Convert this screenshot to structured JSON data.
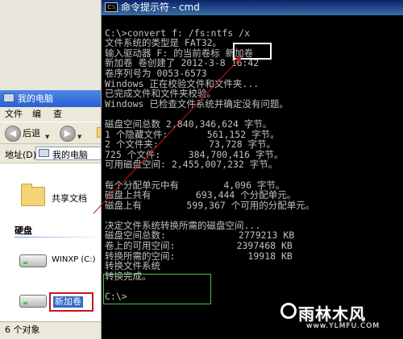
{
  "explorer": {
    "title": "我的电脑",
    "menu": [
      "文件",
      "编",
      "查"
    ],
    "back_label": "后退",
    "address_label": "地址(D)",
    "address_value": "我的电脑",
    "folder_label": "共享文档",
    "section_hard_disk": "硬盘",
    "drive1_label": "WINXP (C:)",
    "drive2_label": "新加卷",
    "status_text": "6 个对象"
  },
  "cmd": {
    "title": "命令提示符 - cmd",
    "icon_text": "C:\\",
    "lines": [
      "",
      "C:\\>convert f: /fs:ntfs /x",
      "文件系统的类型是 FAT32。",
      "输入驱动器 F: 的当前卷标 新加卷",
      "新加卷 卷创建了 2012-3-8 16:42",
      "卷序列号为 0053-6573",
      "Windows 正在校验文件和文件夹...",
      "已完成文件和文件夹校验。",
      "Windows 已检查文件系统并确定没有问题。",
      "",
      "磁盘空间总数 2,840,346,624 字节。",
      "1 个隐藏文件:       561,152 字节。",
      "2 个文件夹:         73,728 字节。",
      "725 个文件:     384,700,416 字节。",
      "可用磁盘空间: 2,455,007,232 字节。",
      "",
      "每个分配单元中有        4,096 字节。",
      "磁盘上共有        693,444 个分配单元。",
      "磁盘上有        599,367 个可用的分配单元。",
      "",
      "决定文件系统转换所需的磁盘空间...",
      "磁盘空间总数:             2779213 KB",
      "卷上的可用空间:           2397468 KB",
      "转换所需的空间:             19918 KB",
      "转换文件系统",
      "转换完成。",
      "",
      "C:\\>"
    ]
  },
  "watermark": {
    "brand": "雨林木风",
    "url": "www.YLMFU.COM"
  },
  "colors": {
    "cmd_text": "#c0c0c0",
    "highlight_red": "#c8141d",
    "highlight_green": "#47c247",
    "xp_title_blue": "#2a5fd3"
  }
}
